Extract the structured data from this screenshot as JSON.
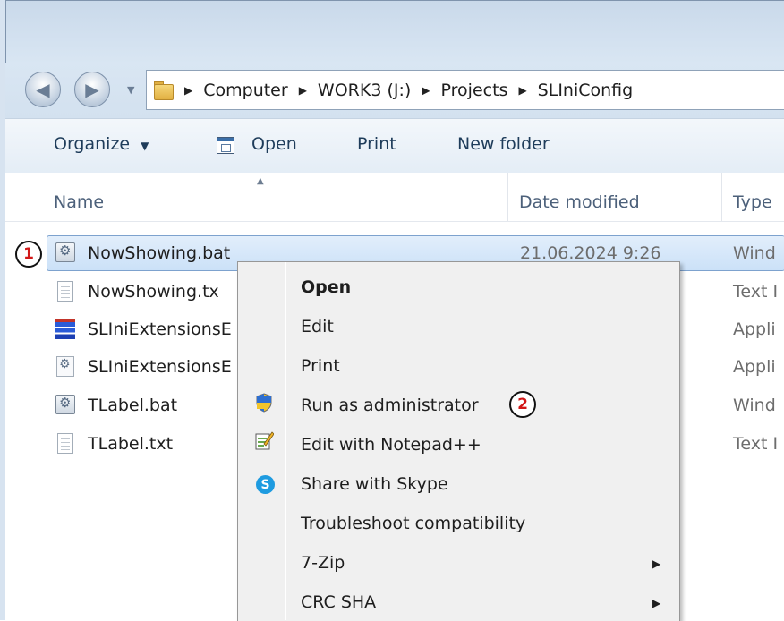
{
  "address": {
    "crumbs": [
      "Computer",
      "WORK3 (J:)",
      "Projects",
      "SLIniConfig"
    ]
  },
  "toolbar": {
    "organize": "Organize",
    "open": "Open",
    "print": "Print",
    "new_folder": "New folder"
  },
  "columns": {
    "name": "Name",
    "date": "Date modified",
    "type": "Type"
  },
  "files": [
    {
      "name": "NowShowing.bat",
      "date": "21.06.2024 9:26",
      "type": "Wind"
    },
    {
      "name": "NowShowing.tx",
      "type": "Text I"
    },
    {
      "name": "SLIniExtensionsE",
      "type": "Appli"
    },
    {
      "name": "SLIniExtensionsE",
      "type": "Appli"
    },
    {
      "name": "TLabel.bat",
      "type": "Wind"
    },
    {
      "name": "TLabel.txt",
      "type": "Text I"
    }
  ],
  "context_menu": {
    "items": [
      {
        "label": "Open"
      },
      {
        "label": "Edit"
      },
      {
        "label": "Print"
      },
      {
        "label": "Run as administrator"
      },
      {
        "label": "Edit with Notepad++"
      },
      {
        "label": "Share with Skype"
      },
      {
        "label": "Troubleshoot compatibility"
      },
      {
        "label": "7-Zip"
      },
      {
        "label": "CRC SHA"
      }
    ]
  },
  "callouts": {
    "first": "1",
    "second": "2"
  },
  "colors": {
    "selection": "#cbe1f8",
    "callout_number": "#d21818",
    "skype": "#1e9be0"
  }
}
